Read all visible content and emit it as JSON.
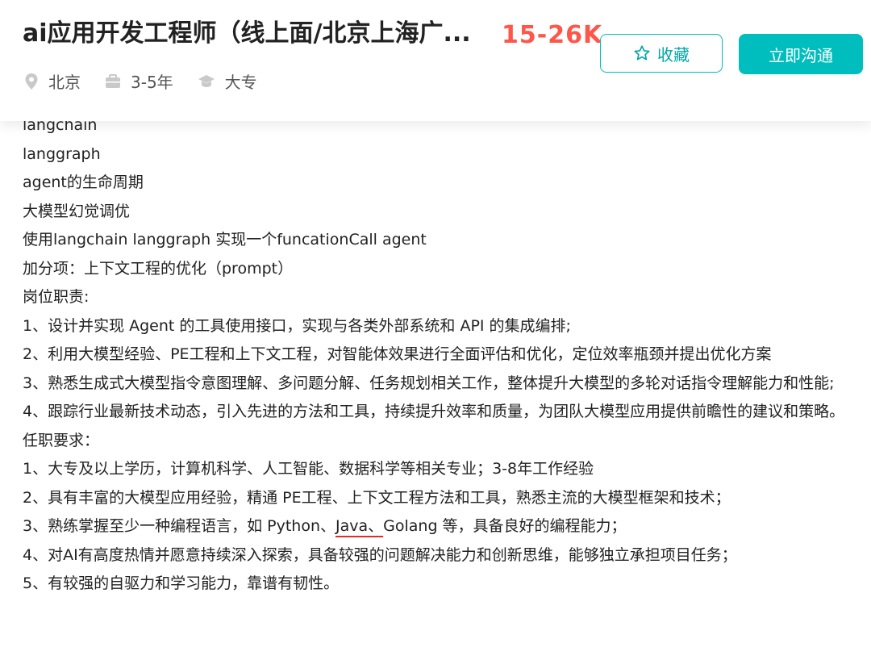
{
  "job": {
    "title": "ai应用开发工程师（线上面/北京上海广...",
    "salary": "15-26K",
    "location": "北京",
    "experience": "3-5年",
    "education": "大专",
    "favorite_label": "收藏",
    "chat_label": "立即沟通"
  },
  "colors": {
    "accent": "#00bebd",
    "salary": "#fe574a",
    "underline": "#e02b2b"
  },
  "description": {
    "lines": [
      "langchain",
      "langgraph",
      "agent的生命周期",
      "大模型幻觉调优",
      "使用langchain   langgraph 实现一个funcationCall agent",
      "加分项：上下文工程的优化（prompt）",
      "岗位职责:",
      "1、设计并实现 Agent 的工具使用接口，实现与各类外部系统和 API 的集成编排;",
      "2、利用大模型经验、PE工程和上下文工程，对智能体效果进行全面评估和优化，定位效率瓶颈并提出优化方案",
      "3、熟悉生成式大模型指令意图理解、多问题分解、任务规划相关工作，整体提升大模型的多轮对话指令理解能力和性能;",
      "4、跟踪行业最新技术动态，引入先进的方法和工具，持续提升效率和质量，为团队大模型应用提供前瞻性的建议和策略。",
      "任职要求：",
      "1、大专及以上学历，计算机科学、人工智能、数据科学等相关专业；3-8年工作经验",
      "2、具有丰富的大模型应用经验，精通 PE工程、上下文工程方法和工具，熟悉主流的大模型框架和技术；"
    ],
    "line16_before": "3、熟练掌握至少一种编程语言，如 Python、",
    "line16_underlined": "Java、",
    "line16_after": "Golang 等，具备良好的编程能力；",
    "line17": "4、对AI有高度热情并愿意持续深入探索，具备较强的问题解决能力和创新思维，能够独立承担项目任务；",
    "line18": "5、有较强的自驱力和学习能力，靠谱有韧性。"
  }
}
